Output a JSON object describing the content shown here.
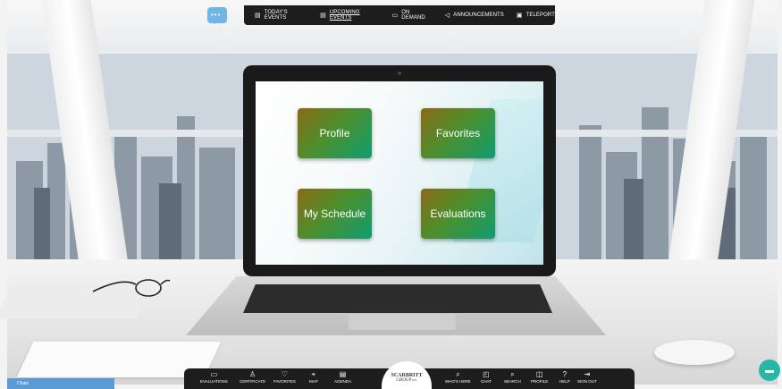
{
  "top_nav": {
    "items": [
      {
        "icon": "calendar-icon",
        "glyph": "▤",
        "label": "TODAY'S EVENTS"
      },
      {
        "icon": "calendar-icon",
        "glyph": "▤",
        "label": "UPCOMING EVENTS"
      },
      {
        "icon": "screen-icon",
        "glyph": "▭",
        "label": "ON DEMAND"
      },
      {
        "icon": "megaphone-icon",
        "glyph": "◁",
        "label": "ANNOUNCEMENTS"
      },
      {
        "icon": "teleport-icon",
        "glyph": "▣",
        "label": "TELEPORT"
      }
    ]
  },
  "chat_bubble": {
    "glyph": "•••",
    "color": "#6fb6e6"
  },
  "tiles": [
    {
      "label": "Profile"
    },
    {
      "label": "Favorites"
    },
    {
      "label": "My Schedule"
    },
    {
      "label": "Evaluations"
    }
  ],
  "bottom_nav": {
    "left_items": [
      {
        "icon": "folder-icon",
        "glyph": "▭",
        "label": "EVALUATIONS"
      },
      {
        "icon": "certificate-icon",
        "glyph": "♙",
        "label": "CERTIFICATE"
      },
      {
        "icon": "heart-icon",
        "glyph": "♡",
        "label": "FAVORITES"
      },
      {
        "icon": "map-icon",
        "glyph": "⌖",
        "label": "MAP"
      },
      {
        "icon": "agenda-icon",
        "glyph": "▤",
        "label": "AGENDA"
      }
    ],
    "logo": {
      "line1": "SCARBRITT",
      "line2": "GROUP",
      "suffix": "INC"
    },
    "right_items": [
      {
        "icon": "search-people-icon",
        "glyph": "⌕",
        "label": "WHO'S HERE"
      },
      {
        "icon": "chat-icon",
        "glyph": "◰",
        "label": "CHAT"
      },
      {
        "icon": "search-icon",
        "glyph": "⌕",
        "label": "SEARCH"
      },
      {
        "icon": "profile-icon",
        "glyph": "◫",
        "label": "PROFILE"
      },
      {
        "icon": "help-icon",
        "glyph": "?",
        "label": "HELP"
      },
      {
        "icon": "sign-out-icon",
        "glyph": "⇥",
        "label": "SIGN OUT"
      }
    ]
  },
  "chats_bar": {
    "label": "Chats"
  },
  "help_button": {
    "glyph": "▬",
    "color": "#27b7a6"
  }
}
